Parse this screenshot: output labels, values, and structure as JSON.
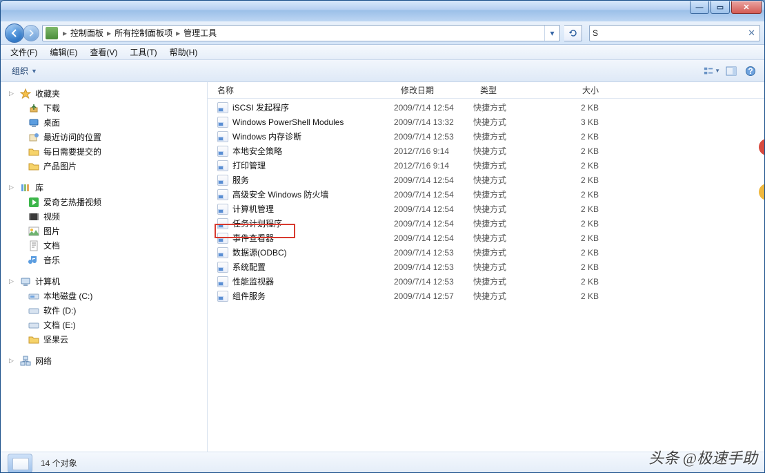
{
  "breadcrumb": {
    "seg0": "控制面板",
    "seg1": "所有控制面板项",
    "seg2": "管理工具"
  },
  "search": {
    "value": "S"
  },
  "menu": {
    "file": "文件(F)",
    "edit": "编辑(E)",
    "view": "查看(V)",
    "tools": "工具(T)",
    "help": "帮助(H)"
  },
  "toolbar": {
    "organize": "组织"
  },
  "sidebar": {
    "favorites": {
      "header": "收藏夹",
      "items": [
        "下载",
        "桌面",
        "最近访问的位置",
        "每日需要提交的",
        "产品图片"
      ]
    },
    "libraries": {
      "header": "库",
      "items": [
        "爱奇艺热播视频",
        "视频",
        "图片",
        "文档",
        "音乐"
      ]
    },
    "computer": {
      "header": "计算机",
      "items": [
        "本地磁盘 (C:)",
        "软件 (D:)",
        "文档 (E:)",
        "坚果云"
      ]
    },
    "network": {
      "header": "网络"
    }
  },
  "columns": {
    "name": "名称",
    "date": "修改日期",
    "type": "类型",
    "size": "大小"
  },
  "files": [
    {
      "name": "iSCSI 发起程序",
      "date": "2009/7/14 12:54",
      "type": "快捷方式",
      "size": "2 KB"
    },
    {
      "name": "Windows PowerShell Modules",
      "date": "2009/7/14 13:32",
      "type": "快捷方式",
      "size": "3 KB"
    },
    {
      "name": "Windows 内存诊断",
      "date": "2009/7/14 12:53",
      "type": "快捷方式",
      "size": "2 KB"
    },
    {
      "name": "本地安全策略",
      "date": "2012/7/16 9:14",
      "type": "快捷方式",
      "size": "2 KB"
    },
    {
      "name": "打印管理",
      "date": "2012/7/16 9:14",
      "type": "快捷方式",
      "size": "2 KB"
    },
    {
      "name": "服务",
      "date": "2009/7/14 12:54",
      "type": "快捷方式",
      "size": "2 KB"
    },
    {
      "name": "高级安全 Windows 防火墙",
      "date": "2009/7/14 12:54",
      "type": "快捷方式",
      "size": "2 KB"
    },
    {
      "name": "计算机管理",
      "date": "2009/7/14 12:54",
      "type": "快捷方式",
      "size": "2 KB"
    },
    {
      "name": "任务计划程序",
      "date": "2009/7/14 12:54",
      "type": "快捷方式",
      "size": "2 KB"
    },
    {
      "name": "事件查看器",
      "date": "2009/7/14 12:54",
      "type": "快捷方式",
      "size": "2 KB"
    },
    {
      "name": "数据源(ODBC)",
      "date": "2009/7/14 12:53",
      "type": "快捷方式",
      "size": "2 KB"
    },
    {
      "name": "系统配置",
      "date": "2009/7/14 12:53",
      "type": "快捷方式",
      "size": "2 KB"
    },
    {
      "name": "性能监视器",
      "date": "2009/7/14 12:53",
      "type": "快捷方式",
      "size": "2 KB"
    },
    {
      "name": "组件服务",
      "date": "2009/7/14 12:57",
      "type": "快捷方式",
      "size": "2 KB"
    }
  ],
  "status": {
    "count": "14 个对象"
  },
  "watermark": "头条 @极速手助"
}
